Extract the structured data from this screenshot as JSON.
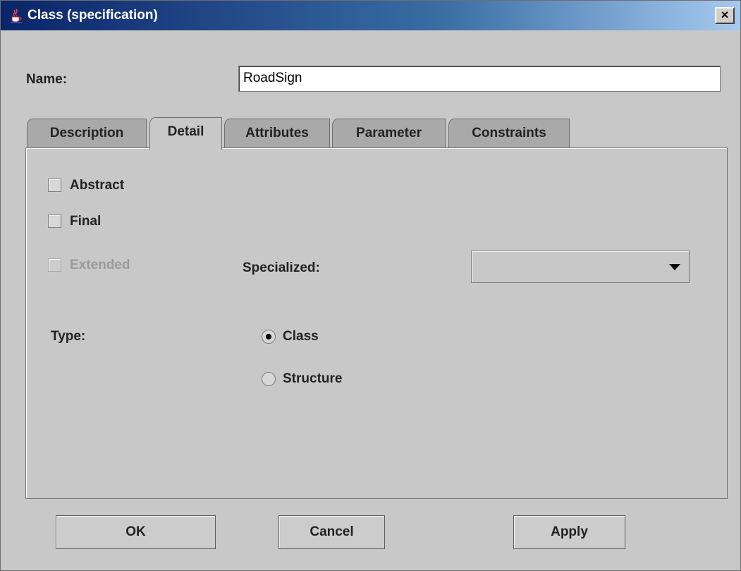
{
  "window": {
    "title": "Class (specification)",
    "close_label": "×"
  },
  "name_field": {
    "label": "Name:",
    "value": "RoadSign"
  },
  "tabs": [
    {
      "label": "Description"
    },
    {
      "label": "Detail",
      "active": true
    },
    {
      "label": "Attributes"
    },
    {
      "label": "Parameter"
    },
    {
      "label": "Constraints"
    }
  ],
  "detail": {
    "abstract": {
      "label": "Abstract",
      "checked": false
    },
    "final": {
      "label": "Final",
      "checked": false
    },
    "extended": {
      "label": "Extended",
      "checked": false,
      "disabled": true
    },
    "specialized": {
      "label": "Specialized:",
      "value": ""
    },
    "type": {
      "label": "Type:",
      "options": [
        {
          "label": "Class",
          "selected": true
        },
        {
          "label": "Structure",
          "selected": false
        }
      ]
    }
  },
  "buttons": {
    "ok": "OK",
    "cancel": "Cancel",
    "apply": "Apply"
  },
  "icons": {
    "title_icon": "java-cup-icon",
    "close_icon": "close-icon",
    "dropdown_icon": "chevron-down-icon"
  }
}
